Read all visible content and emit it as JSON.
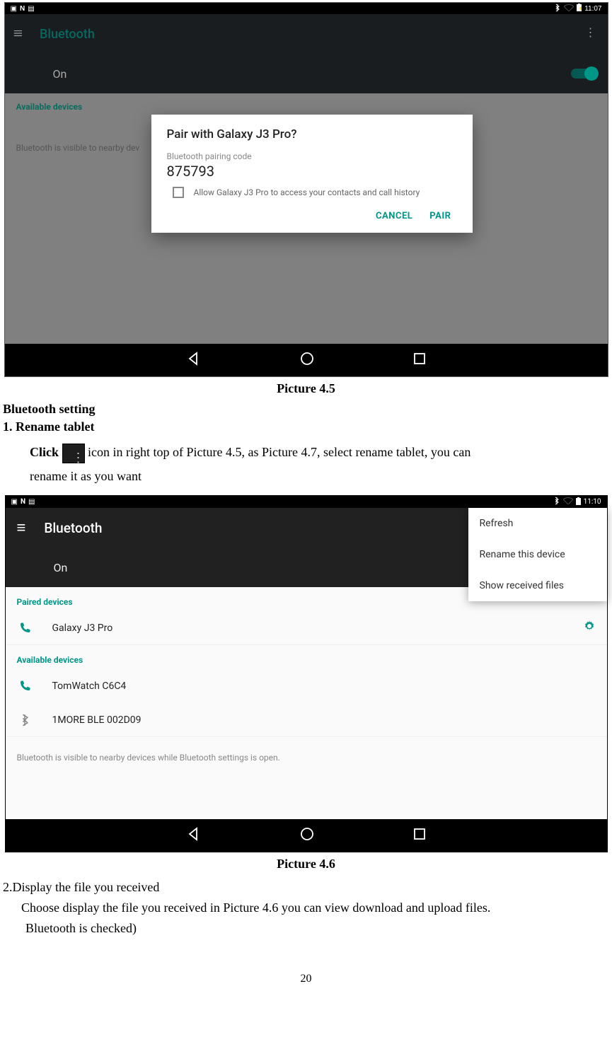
{
  "s1": {
    "status_time": "11:07",
    "appbar_title": "Bluetooth",
    "switch_label": "On",
    "section_label": "Available devices",
    "visibility_text": "Bluetooth is visible to nearby dev",
    "dialog": {
      "title": "Pair with Galaxy J3 Pro?",
      "sub": "Bluetooth pairing code",
      "code": "875793",
      "check_text": "Allow Galaxy J3 Pro to access your contacts and call history",
      "cancel": "CANCEL",
      "pair": "PAIR"
    }
  },
  "caption1": "Picture 4.5",
  "doc": {
    "bt_setting": "Bluetooth setting",
    "rename_heading": "1.    Rename  tablet",
    "click_label": "Click ",
    "rename_text_tail": "  icon in right top of Picture 4.5, as Picture 4.7, select rename tablet, you can",
    "rename_line2": "rename it as you want"
  },
  "s2": {
    "status_time": "11:10",
    "appbar_title": "Bluetooth",
    "switch_label": "On",
    "popup": [
      "Refresh",
      "Rename this device",
      "Show received files"
    ],
    "paired_label": "Paired devices",
    "paired_device": "Galaxy J3 Pro",
    "available_label": "Available devices",
    "devices": [
      "TomWatch C6C4",
      "1MORE BLE 002D09"
    ],
    "visibility_text": "Bluetooth is visible to nearby devices while Bluetooth settings is open."
  },
  "caption2": "Picture 4.6",
  "doc2": {
    "line1": "2.Display the file you received",
    "line2": "Choose display the file you received in Picture 4.6 you can view download and upload files.",
    "line3": "Bluetooth is checked)"
  },
  "page_num": "20"
}
